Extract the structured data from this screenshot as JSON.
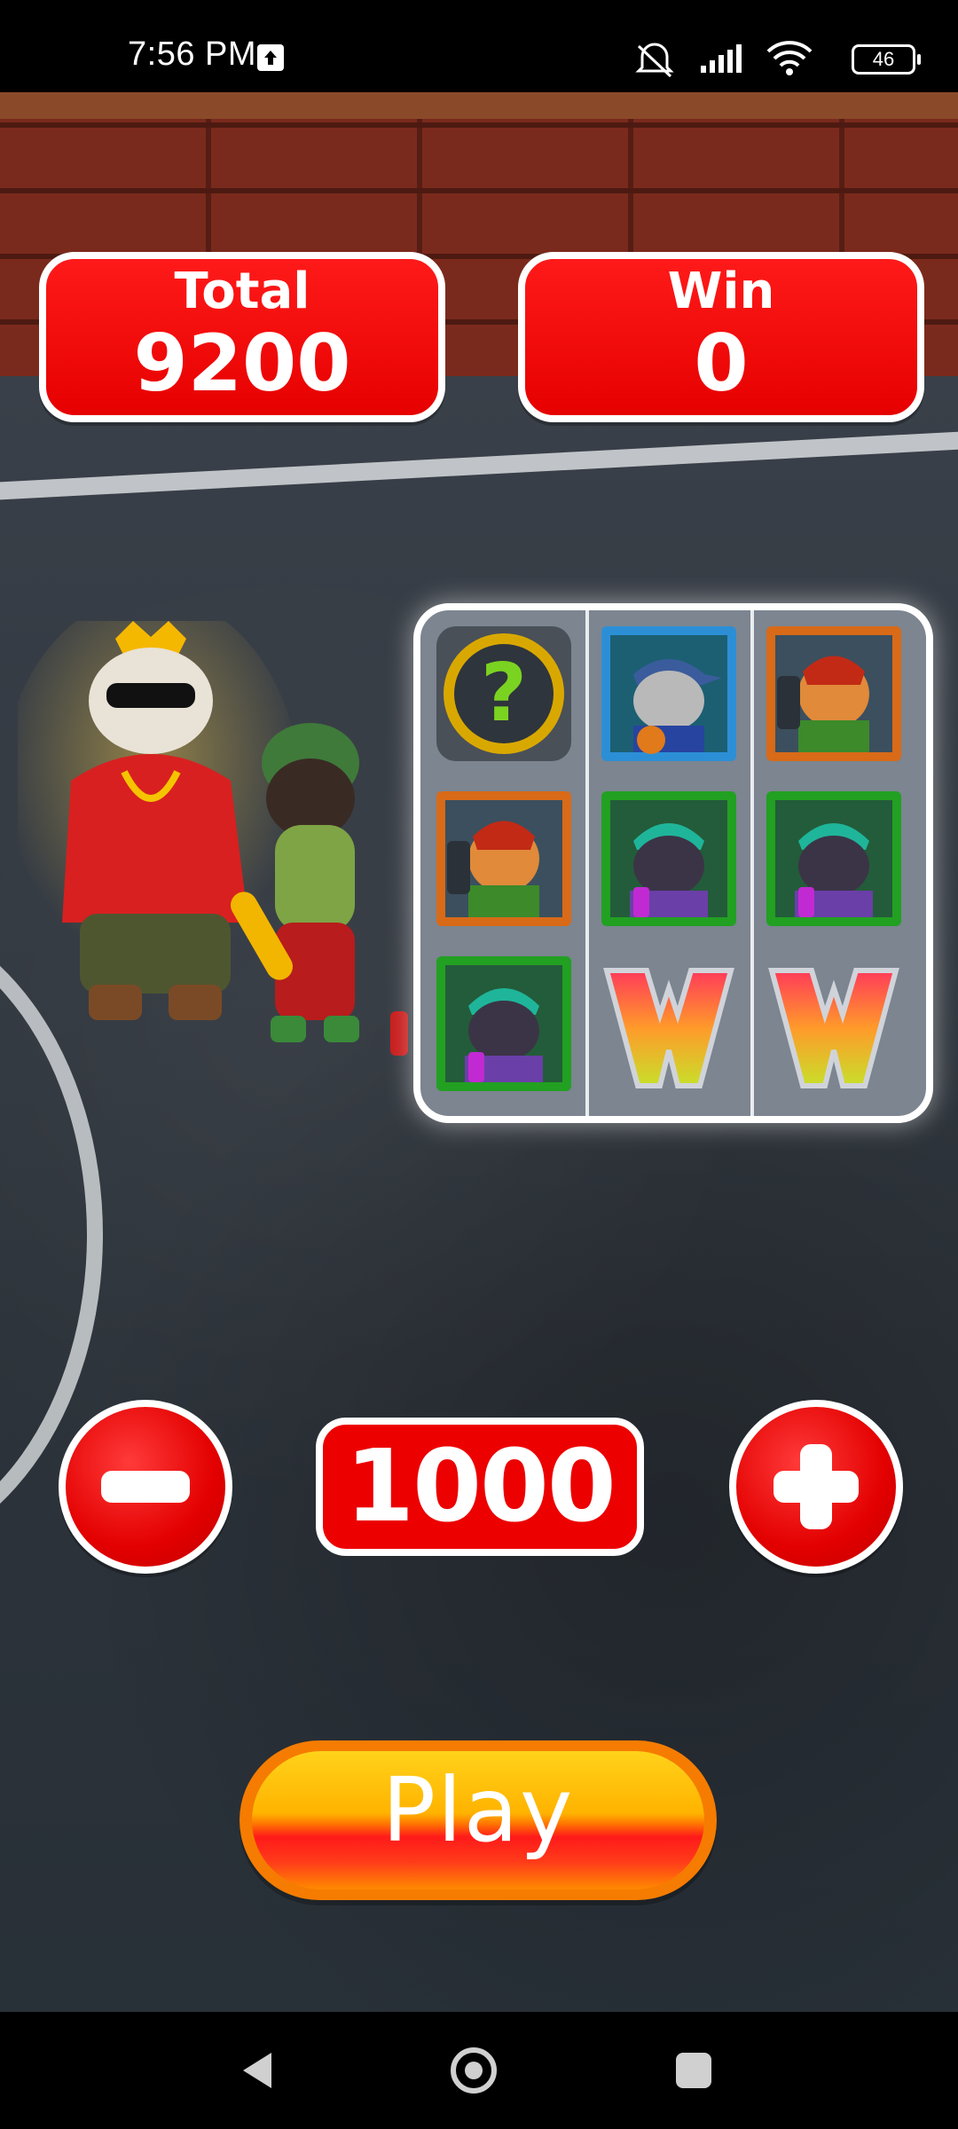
{
  "status_bar": {
    "time": "7:56 PM",
    "battery": "46",
    "icons": [
      "upload-icon",
      "mute-icon",
      "signal-icon",
      "wifi-icon",
      "battery-icon"
    ]
  },
  "scoreboard": {
    "total_label": "Total",
    "total_value": "9200",
    "win_label": "Win",
    "win_value": "0"
  },
  "reels": {
    "columns": [
      [
        "mystery-question-symbol",
        "redhead-boombox-cat-symbol",
        "graffiti-black-cat-symbol"
      ],
      [
        "basketball-cap-cat-symbol",
        "graffiti-black-cat-symbol",
        "w-wild-symbol"
      ],
      [
        "redhead-boombox-cat-symbol",
        "graffiti-black-cat-symbol",
        "w-wild-symbol"
      ]
    ]
  },
  "bet": {
    "value": "1000"
  },
  "play_button": {
    "label": "Play"
  },
  "colors": {
    "panel_red": "#e60000",
    "panel_border": "#ffffff",
    "play_orange": "#ff8a00",
    "play_yellow": "#ffd21a"
  }
}
